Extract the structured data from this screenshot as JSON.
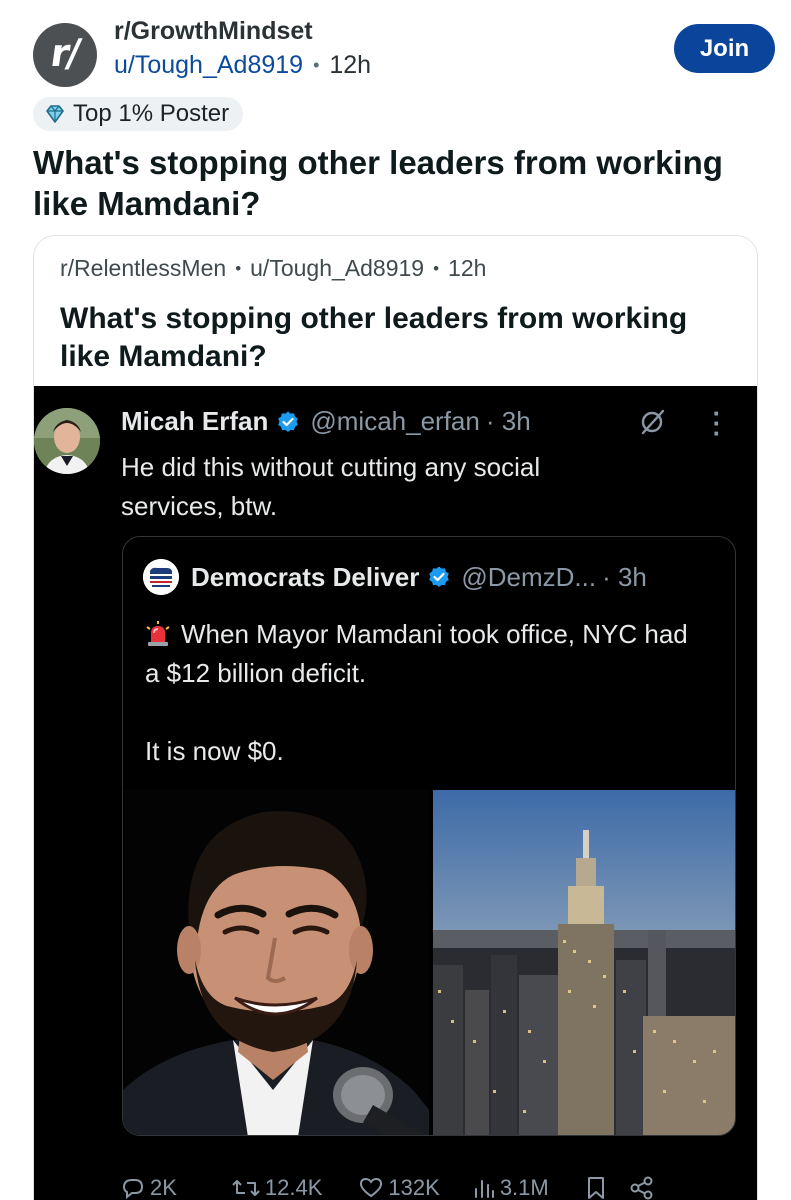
{
  "header": {
    "subreddit": "r/GrowthMindset",
    "author": "u/Tough_Ad8919",
    "time": "12h",
    "join_label": "Join",
    "logo_text": "r/"
  },
  "badge": {
    "label": "Top 1% Poster",
    "icon": "diamond-icon"
  },
  "post": {
    "title": "What's stopping other leaders from working like Mamdani?"
  },
  "crosspost": {
    "subreddit": "r/RelentlessMen",
    "author": "u/Tough_Ad8919",
    "time": "12h",
    "title": "What's stopping other leaders from working like Mamdani?"
  },
  "tweet": {
    "name": "Micah Erfan",
    "handle": "@micah_erfan",
    "time": "· 3h",
    "body": "He did this without cutting any social services, btw.",
    "quote": {
      "name": "Democrats Deliver",
      "handle": "@DemzD...",
      "time": "· 3h",
      "line1": "When Mayor Mamdani took office, NYC had a $12 billion deficit.",
      "line2": "It is now $0."
    },
    "actions": {
      "replies": "2K",
      "reposts": "12.4K",
      "likes": "132K",
      "views": "3.1M"
    }
  },
  "colors": {
    "join_bg": "#0a449b",
    "author_link": "#0b4a9e",
    "tweet_bg": "#000000",
    "verified": "#1d9bf0"
  }
}
